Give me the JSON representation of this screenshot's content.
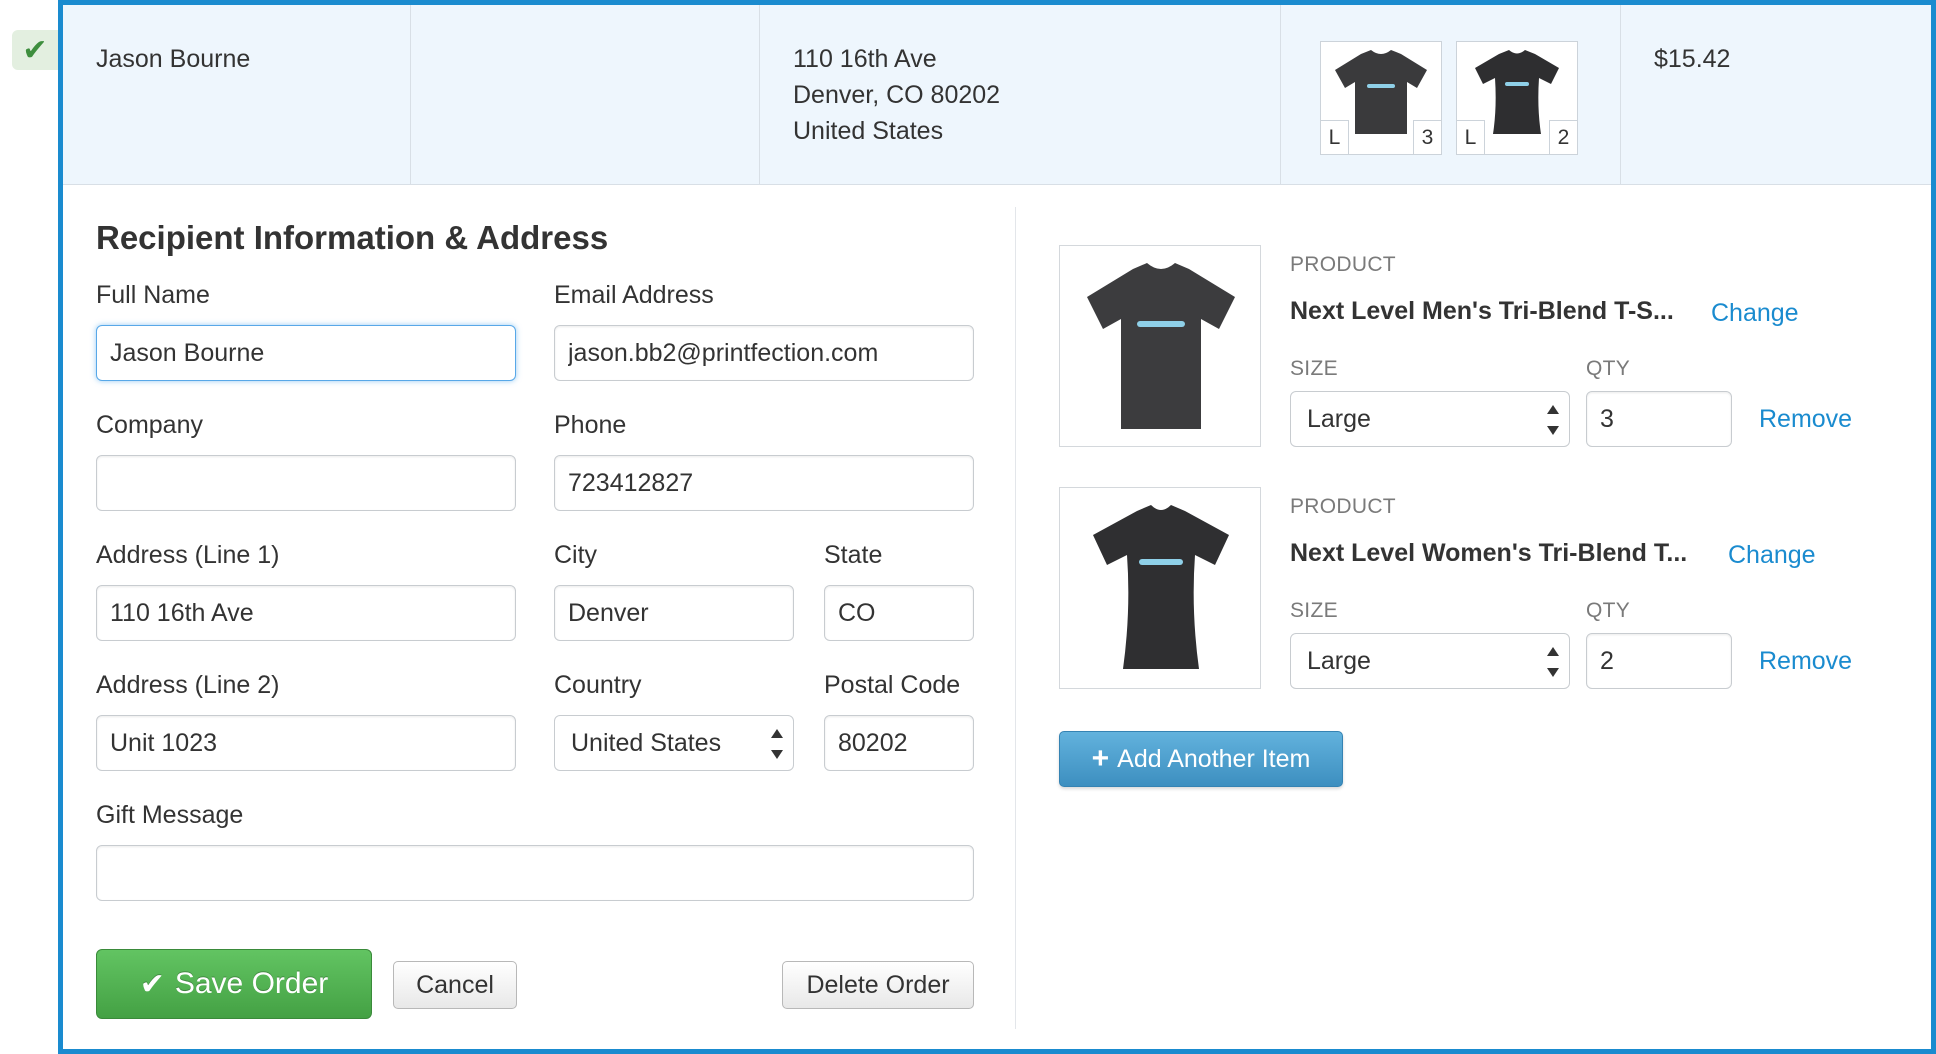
{
  "summary": {
    "name": "Jason Bourne",
    "company": "",
    "address_line1": "110 16th Ave",
    "address_line2": "Denver, CO 80202",
    "address_line3": "United States",
    "items": [
      {
        "size": "L",
        "qty": "3"
      },
      {
        "size": "L",
        "qty": "2"
      }
    ],
    "total": "$15.42"
  },
  "form": {
    "title": "Recipient Information & Address",
    "full_name_label": "Full Name",
    "full_name_value": "Jason Bourne",
    "email_label": "Email Address",
    "email_value": "jason.bb2@printfection.com",
    "company_label": "Company",
    "company_value": "",
    "phone_label": "Phone",
    "phone_value": "723412827",
    "address1_label": "Address (Line 1)",
    "address1_value": "110 16th Ave",
    "city_label": "City",
    "city_value": "Denver",
    "state_label": "State",
    "state_value": "CO",
    "address2_label": "Address (Line 2)",
    "address2_value": "Unit 1023",
    "country_label": "Country",
    "country_value": "United States",
    "postal_label": "Postal Code",
    "postal_value": "80202",
    "gift_label": "Gift Message",
    "gift_value": "",
    "save_label": "Save Order",
    "cancel_label": "Cancel",
    "delete_label": "Delete Order"
  },
  "products": [
    {
      "product_label": "PRODUCT",
      "name": "Next Level Men's Tri-Blend T-S...",
      "change_label": "Change",
      "size_label": "SIZE",
      "size_value": "Large",
      "qty_label": "QTY",
      "qty_value": "3",
      "remove_label": "Remove"
    },
    {
      "product_label": "PRODUCT",
      "name": "Next Level Women's Tri-Blend T...",
      "change_label": "Change",
      "size_label": "SIZE",
      "size_value": "Large",
      "qty_label": "QTY",
      "qty_value": "2",
      "remove_label": "Remove"
    }
  ],
  "add_item_label": "Add Another Item",
  "icons": {
    "status": "checkmark-icon",
    "save": "checkmark-icon",
    "add": "plus-icon",
    "select": "updown-arrows-icon"
  },
  "colors": {
    "accent": "#1a8bcf",
    "save_green": "#4cae4c",
    "add_blue": "#4a9bcc",
    "summary_bg": "#eef6fd"
  }
}
